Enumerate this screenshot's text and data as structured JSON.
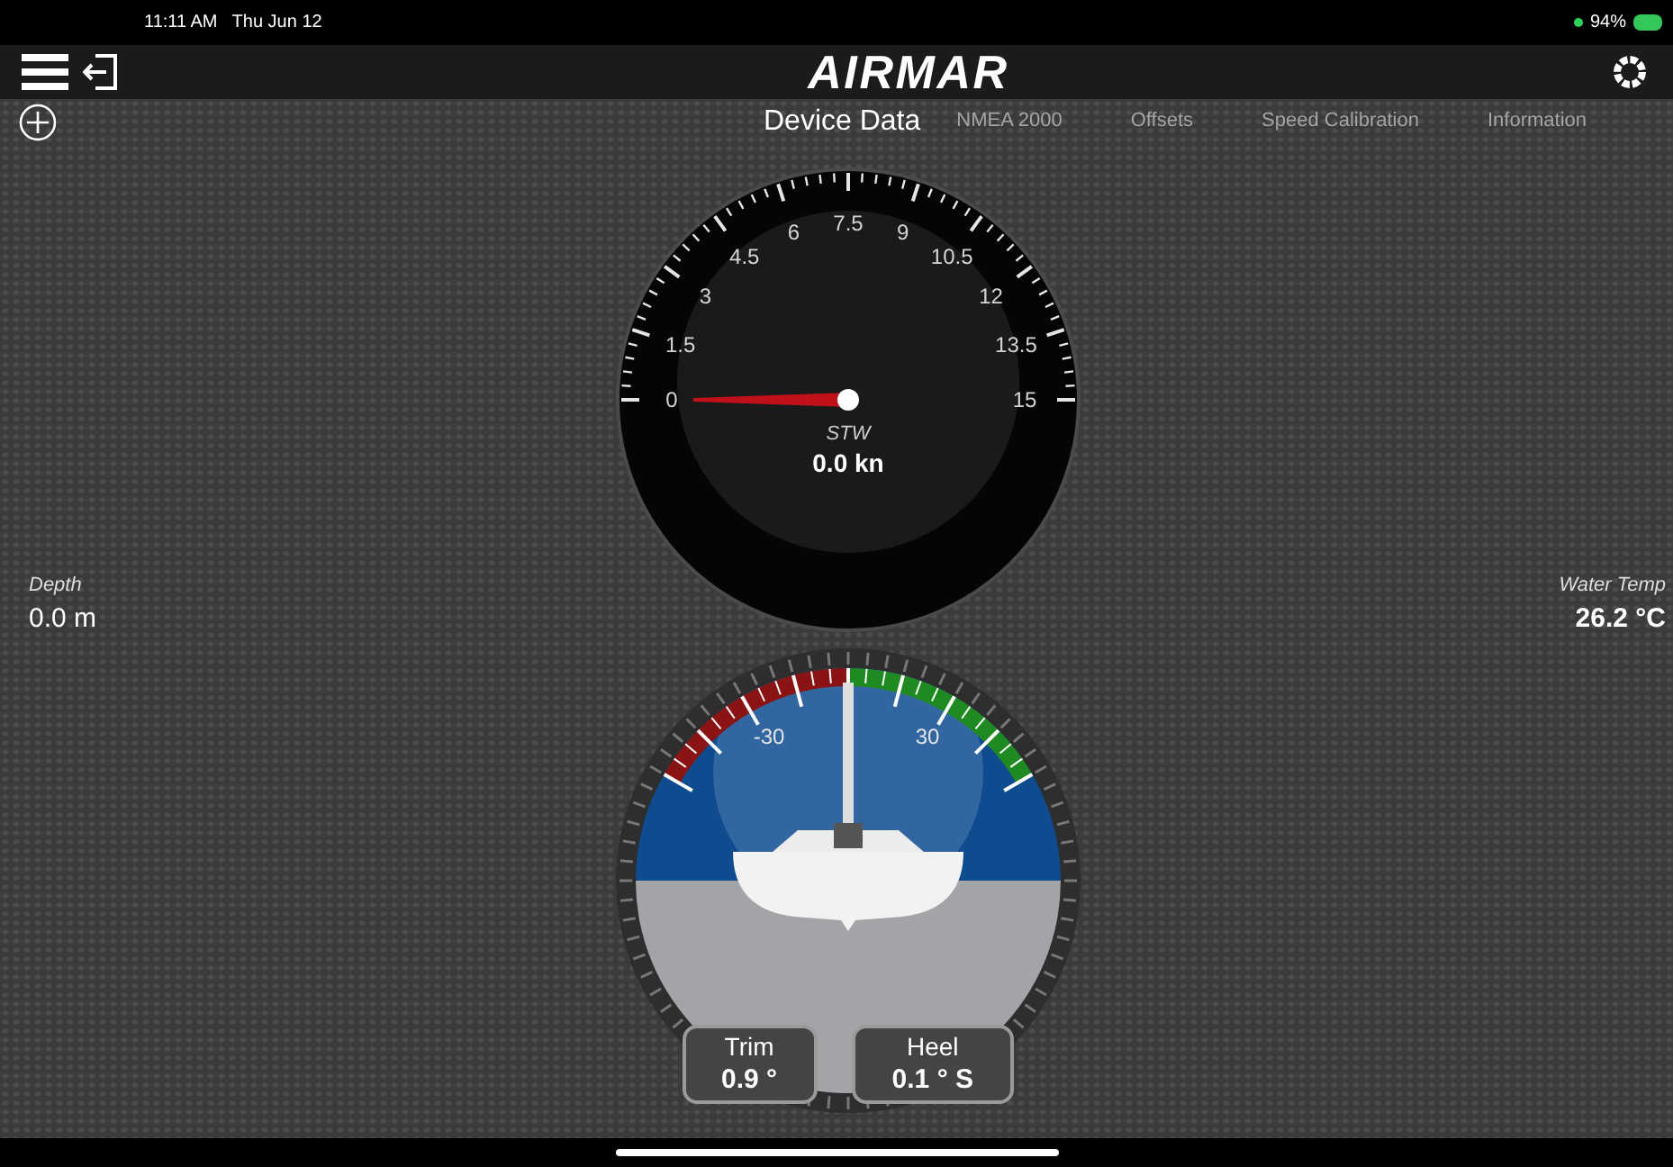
{
  "status_bar": {
    "time": "11:11 AM",
    "date": "Thu Jun 12",
    "battery": "94%"
  },
  "header": {
    "logo": "AIRMAR"
  },
  "tabs": [
    {
      "label": "Device Data",
      "selected": true
    },
    {
      "label": "NMEA 2000",
      "selected": false
    },
    {
      "label": "Offsets",
      "selected": false
    },
    {
      "label": "Speed Calibration",
      "selected": false
    },
    {
      "label": "Information",
      "selected": false
    }
  ],
  "speed_gauge": {
    "scale": [
      "0",
      "1.5",
      "3",
      "4.5",
      "6",
      "7.5",
      "9",
      "10.5",
      "12",
      "13.5",
      "15"
    ],
    "label": "STW",
    "value": "0.0 kn"
  },
  "depth": {
    "label": "Depth",
    "value": "0.0 m"
  },
  "water_temp": {
    "label": "Water Temp",
    "value": "26.2 °C"
  },
  "attitude": {
    "scale": [
      "-30",
      "30"
    ],
    "trim": {
      "label": "Trim",
      "value": "0.9 °"
    },
    "heel": {
      "label": "Heel",
      "value": "0.1 ° S"
    }
  }
}
